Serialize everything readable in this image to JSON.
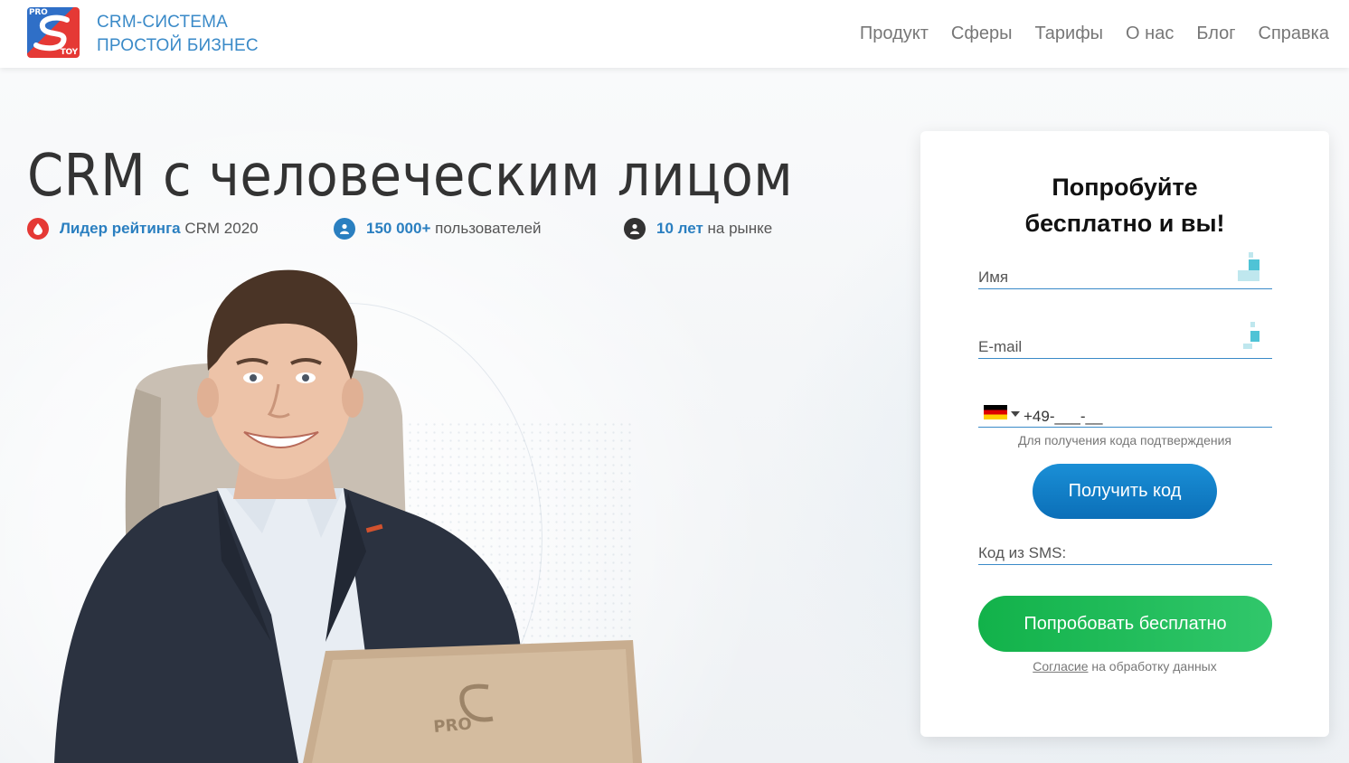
{
  "header": {
    "logo": {
      "top_text": "PRO",
      "bottom_text": "TOY"
    },
    "brand_line1": "CRM-СИСТЕМА",
    "brand_line2": "ПРОСТОЙ БИЗНЕС",
    "nav": [
      "Продукт",
      "Сферы",
      "Тарифы",
      "О нас",
      "Блог",
      "Справка"
    ]
  },
  "hero": {
    "title": "CRM с человеческим лицом",
    "stats": [
      {
        "icon": "drop-icon",
        "color": "#e53935",
        "bold": "Лидер рейтинга",
        "rest": "CRM 2020"
      },
      {
        "icon": "user-icon",
        "color": "#2a7fc0",
        "bold": "150 000+",
        "rest": "пользователей"
      },
      {
        "icon": "person-icon",
        "color": "#333333",
        "bold": "10 лет",
        "rest": "на рынке"
      }
    ]
  },
  "form": {
    "title_line1": "Попробуйте",
    "title_line2": "бесплатно и вы!",
    "name_label": "Имя",
    "email_label": "E-mail",
    "phone_value": "+49-___-__",
    "phone_country_flag": "de-flag-icon",
    "phone_hint": "Для получения кода подтверждения",
    "get_code_label": "Получить код",
    "sms_label": "Код из SMS:",
    "try_label": "Попробовать бесплатно",
    "consent_link": "Согласие",
    "consent_rest": "на обработку данных"
  },
  "colors": {
    "accent_blue": "#2a7fc0",
    "button_green": "#12b24a",
    "button_blue": "#0b6fb8"
  }
}
